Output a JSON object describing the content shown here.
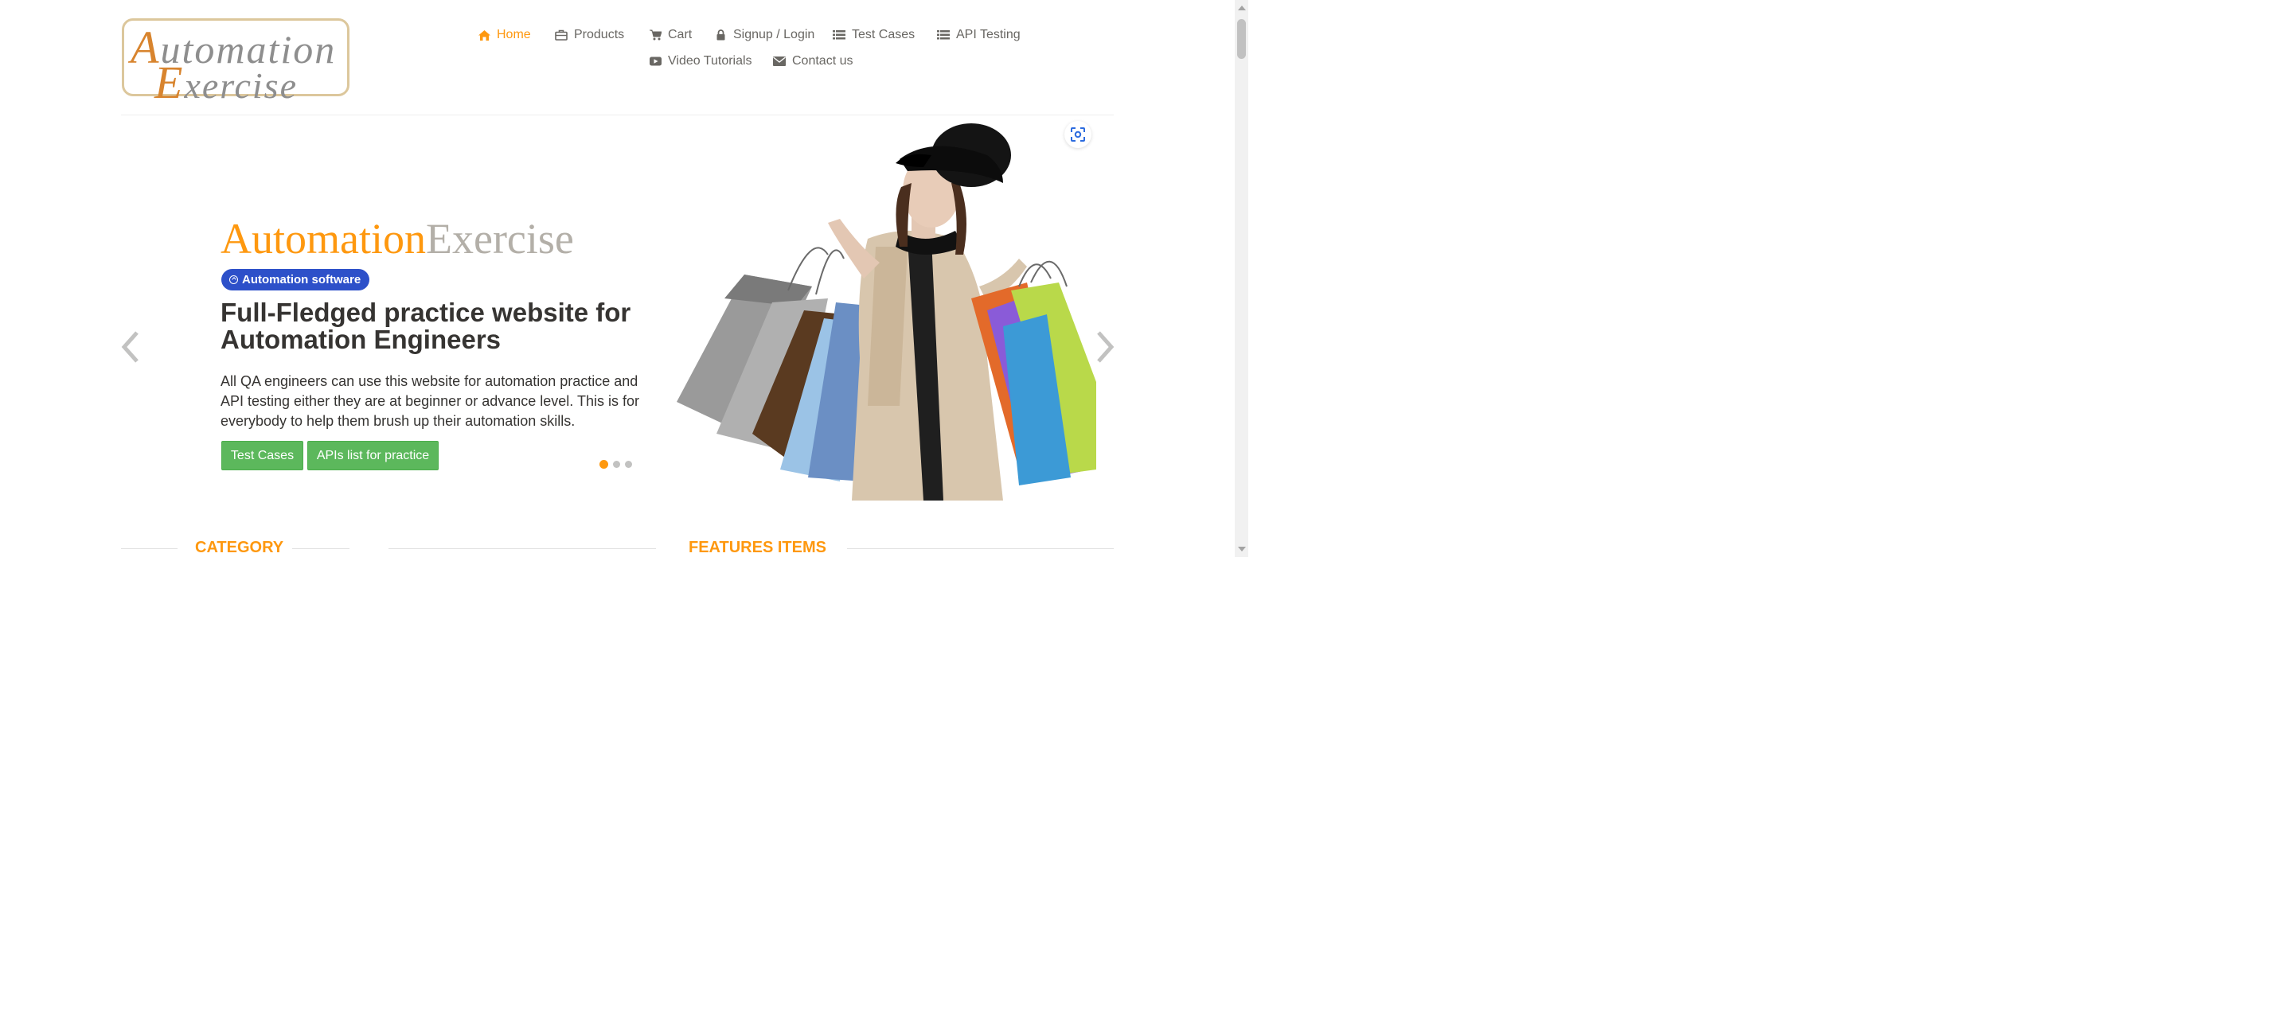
{
  "logo": {
    "line1_first": "A",
    "line1_rest": "utomation",
    "line2_first": "E",
    "line2_rest": "xercise"
  },
  "nav": [
    {
      "label": "Home",
      "icon": "home-icon",
      "active": true
    },
    {
      "label": "Products",
      "icon": "briefcase-icon"
    },
    {
      "label": "Cart",
      "icon": "cart-icon"
    },
    {
      "label": "Signup / Login",
      "icon": "lock-icon"
    },
    {
      "label": "Test Cases",
      "icon": "list-icon"
    },
    {
      "label": "API Testing",
      "icon": "list-icon"
    },
    {
      "label": "Video Tutorials",
      "icon": "youtube-play-icon"
    },
    {
      "label": "Contact us",
      "icon": "envelope-icon"
    }
  ],
  "hero": {
    "title_a": "Automation",
    "title_b": "Exercise",
    "badge": "Automation software",
    "headline": "Full-Fledged practice website for Automation Engineers",
    "description": "All QA engineers can use this website for automation practice and API testing either they are at beginner or advance level. This is for everybody to help them brush up their automation skills.",
    "button_test_cases": "Test Cases",
    "button_apis": "APIs list for practice",
    "slide_count": 3,
    "active_slide": 1
  },
  "sections": {
    "category": "CATEGORY",
    "features": "FEATURES ITEMS"
  },
  "colors": {
    "accent": "#FE980F",
    "button_green": "#5CB85C",
    "badge_blue": "#2D50C9",
    "text_dark": "#363432"
  }
}
